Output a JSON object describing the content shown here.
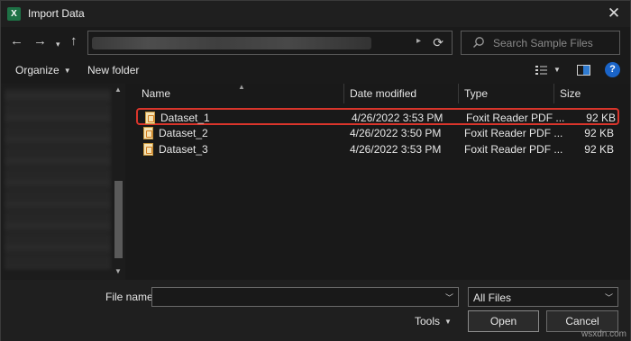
{
  "window": {
    "title": "Import Data",
    "app_icon_letter": "X"
  },
  "nav": {
    "search_placeholder": "Search Sample Files"
  },
  "toolbar": {
    "organize_label": "Organize",
    "new_folder_label": "New folder",
    "help_label": "?"
  },
  "columns": [
    "Name",
    "Date modified",
    "Type",
    "Size"
  ],
  "files": [
    {
      "name": "Dataset_1",
      "date": "4/26/2022 3:53 PM",
      "type": "Foxit Reader PDF ...",
      "size": "92 KB",
      "selected": true
    },
    {
      "name": "Dataset_2",
      "date": "4/26/2022 3:50 PM",
      "type": "Foxit Reader PDF ...",
      "size": "92 KB",
      "selected": false
    },
    {
      "name": "Dataset_3",
      "date": "4/26/2022 3:53 PM",
      "type": "Foxit Reader PDF ...",
      "size": "92 KB",
      "selected": false
    }
  ],
  "footer": {
    "file_name_label": "File name:",
    "file_name_value": "",
    "filter_value": "All Files",
    "tools_label": "Tools",
    "open_label": "Open",
    "cancel_label": "Cancel"
  },
  "watermark": "wsxdn.com",
  "colors": {
    "highlight": "#d9352b",
    "help": "#1a64c8",
    "excel": "#1e7145"
  }
}
